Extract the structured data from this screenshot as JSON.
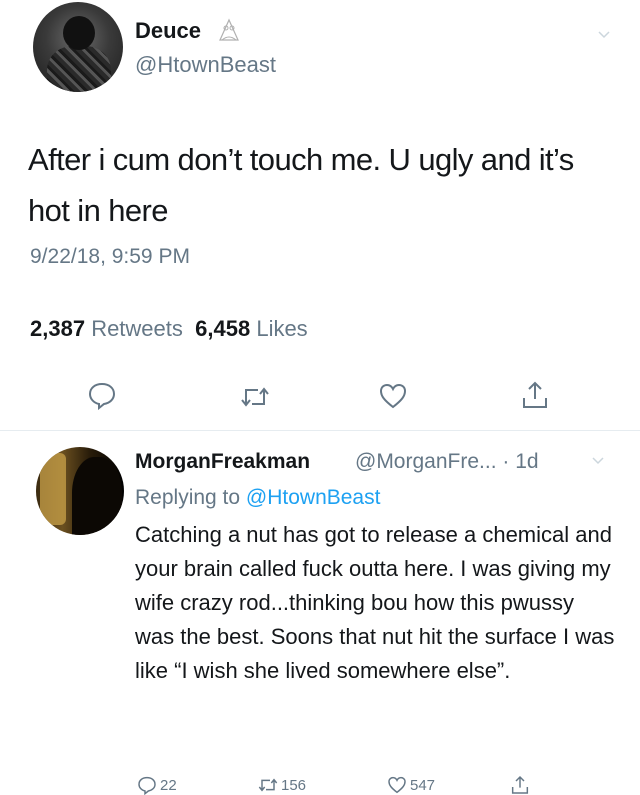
{
  "tweet": {
    "author_name": "Deuce",
    "author_handle": "@HtownBeast",
    "text": "After i cum don’t touch me. U ugly and it’s hot in here",
    "timestamp": "9/22/18, 9:59 PM",
    "retweets_count": "2,387",
    "retweets_label": "Retweets",
    "likes_count": "6,458",
    "likes_label": "Likes",
    "actions": [
      "reply-icon",
      "retweet-icon",
      "like-icon",
      "share-icon"
    ]
  },
  "reply": {
    "author_name": "MorganFreakman",
    "author_handle": "@MorganFre...",
    "time": "· 1d",
    "replying_prefix": "Replying to",
    "replying_to": "@HtownBeast",
    "text": "Catching a nut has got to release a chemical and your brain called fuck outta here. I was giving my wife crazy rod...thinking bou how this pwussy was the best. Soons that nut hit the surface I was like “I wish she lived somewhere else”.",
    "reply_count": "22",
    "retweet_count": "156",
    "like_count": "547"
  },
  "colors": {
    "text": "#14171a",
    "secondary": "#657786",
    "link": "#1da1f2",
    "divider": "#e6ecf0"
  }
}
